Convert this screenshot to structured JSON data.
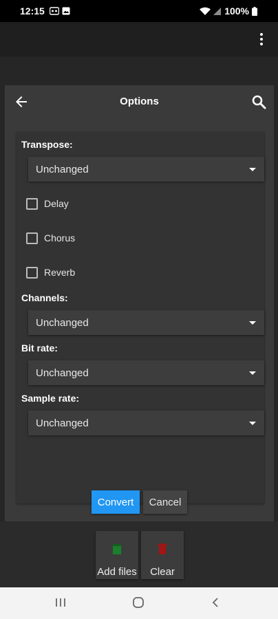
{
  "status": {
    "time": "12:15",
    "battery": "100%",
    "left_icons": [
      "voicemail-icon",
      "image-icon"
    ],
    "right_icons": [
      "wifi-icon",
      "signal-icon",
      "battery-icon"
    ]
  },
  "dialog": {
    "title": "Options",
    "back_icon": "arrow-left-icon",
    "search_icon": "search-icon",
    "transpose": {
      "label": "Transpose:",
      "value": "Unchanged"
    },
    "effects": [
      {
        "label": "Delay",
        "checked": false
      },
      {
        "label": "Chorus",
        "checked": false
      },
      {
        "label": "Reverb",
        "checked": false
      }
    ],
    "channels": {
      "label": "Channels:",
      "value": "Unchanged"
    },
    "bit_rate": {
      "label": "Bit rate:",
      "value": "Unchanged"
    },
    "sample_rate": {
      "label": "Sample rate:",
      "value": "Unchanged"
    },
    "convert_label": "Convert",
    "cancel_label": "Cancel"
  },
  "toolbar": {
    "add_files_label": "Add files",
    "clear_label": "Clear"
  },
  "colors": {
    "accent": "#2196f3",
    "add_icon": "#1b7f2b",
    "clear_icon": "#a31515"
  },
  "nav": [
    "recent-apps-icon",
    "home-icon",
    "back-nav-icon"
  ]
}
